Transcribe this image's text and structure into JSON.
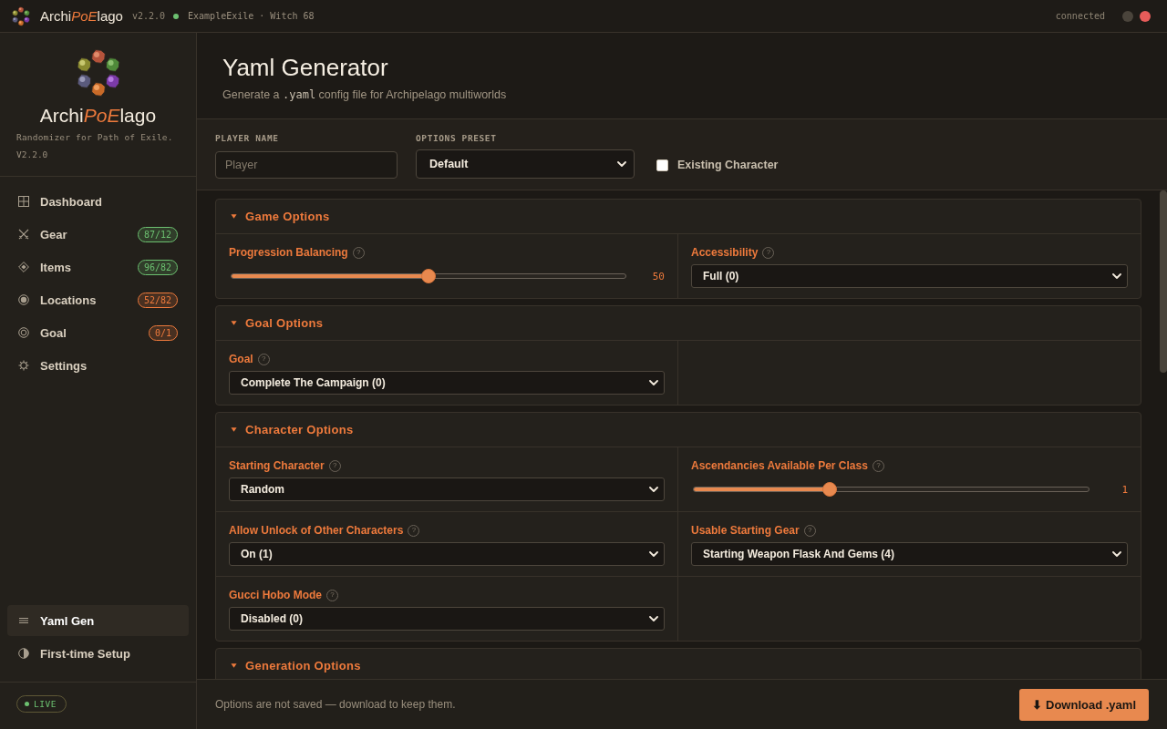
{
  "top_bar": {
    "brand": {
      "before": "Archi",
      "accent": "PoE",
      "after": "lago"
    },
    "version": "v2.2.0",
    "online": true,
    "player": "ExampleExile · Witch 68",
    "status": "connected",
    "window_buttons": [
      {
        "color": "#4a443b"
      },
      {
        "color": "#e65c5a"
      }
    ]
  },
  "sidebar": {
    "title": {
      "before": "Archi",
      "accent": "PoE",
      "after": "lago"
    },
    "tagline": "Randomizer for Path of Exile.",
    "version": "V2.2.0",
    "nav": [
      {
        "kind": "grid",
        "label": "Dashboard",
        "selected": false
      },
      {
        "kind": "swords",
        "label": "Gear",
        "badge": {
          "text": "87/12",
          "color": "#6cc070"
        },
        "selected": false
      },
      {
        "kind": "diamond",
        "label": "Items",
        "badge": {
          "text": "96/82",
          "color": "#6cc070"
        },
        "selected": false
      },
      {
        "kind": "target",
        "label": "Locations",
        "badge": {
          "text": "52/82",
          "color": "#ee7a3c"
        },
        "selected": false
      },
      {
        "kind": "rings",
        "label": "Goal",
        "badge": {
          "text": "0/1",
          "color": "#ee7a3c"
        },
        "selected": false
      },
      {
        "kind": "gear",
        "label": "Settings",
        "selected": false
      }
    ],
    "bottom_nav": [
      {
        "kind": "lines",
        "label": "Yaml Gen",
        "selected": true
      },
      {
        "kind": "halfcircle",
        "label": "First-time Setup",
        "selected": false
      }
    ],
    "live": {
      "label": "LIVE",
      "on": true
    }
  },
  "header": {
    "title": "Yaml Generator",
    "subtitle": {
      "before": "Generate a",
      "code": ".yaml",
      "after": "config file for Archipelago multiworlds"
    }
  },
  "form": {
    "player_name": {
      "label": "PLAYER NAME",
      "placeholder": "Player"
    },
    "options_preset": {
      "label": "OPTIONS PRESET",
      "value": "Default"
    },
    "existing_character": {
      "label": "Existing Character",
      "checked": false
    }
  },
  "sections": [
    {
      "title": "Game Options",
      "expanded": true,
      "fields": [
        {
          "kind": "slider",
          "label": "Progression Balancing",
          "help": "?",
          "level": 0.5,
          "reading": "50"
        },
        {
          "kind": "select",
          "label": "Accessibility",
          "help": "?",
          "value": "Full (0)"
        }
      ]
    },
    {
      "title": "Goal Options",
      "expanded": true,
      "fields": [
        {
          "kind": "select",
          "label": "Goal",
          "help": "?",
          "value": "Complete The Campaign (0)"
        }
      ]
    },
    {
      "title": "Character Options",
      "expanded": true,
      "fields": [
        {
          "kind": "select",
          "label": "Starting Character",
          "help": "?",
          "value": "Random"
        },
        {
          "kind": "slider",
          "label": "Ascendancies Available Per Class",
          "help": "?",
          "level": 0.34,
          "reading": "1"
        },
        {
          "kind": "select",
          "label": "Allow Unlock of Other Characters",
          "help": "?",
          "value": "On (1)"
        },
        {
          "kind": "select",
          "label": "Usable Starting Gear",
          "help": "?",
          "value": "Starting Weapon Flask And Gems (4)"
        },
        {
          "kind": "select",
          "label": "Gucci Hobo Mode",
          "help": "?",
          "value": "Disabled (0)"
        }
      ]
    },
    {
      "title": "Generation Options",
      "expanded": true
    }
  ],
  "footer": {
    "note": "Options are not saved — download to keep them.",
    "download_button": "⬇ Download .yaml"
  }
}
